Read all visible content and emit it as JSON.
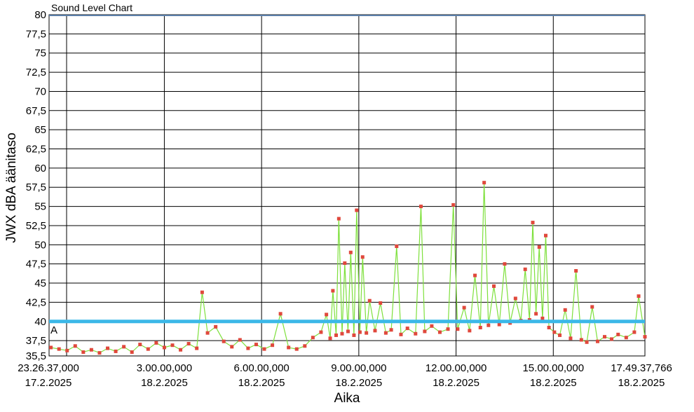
{
  "chart_data": {
    "type": "line",
    "title": "Sound Level Chart",
    "xlabel": "Aika",
    "ylabel": "JWX dBA äänitaso",
    "ylim": [
      35.5,
      80
    ],
    "xlim": [
      "2025-02-17T23:26:37",
      "2025-02-18T17:49:37.766"
    ],
    "grid": true,
    "y_ticks": [
      "80",
      "77,5",
      "75",
      "72,5",
      "70",
      "67,5",
      "65",
      "62,5",
      "60",
      "57,5",
      "55",
      "52,5",
      "50",
      "47,5",
      "45",
      "42,5",
      "40",
      "37,5",
      "35,5"
    ],
    "x_ticks": [
      {
        "time": "2025-02-17T23:26:37",
        "label1": "23.26.37,000",
        "label2": "17.2.2025"
      },
      {
        "time": "2025-02-18T03:00:00",
        "label1": "3.00.00,000",
        "label2": "18.2.2025"
      },
      {
        "time": "2025-02-18T06:00:00",
        "label1": "6.00.00,000",
        "label2": "18.2.2025"
      },
      {
        "time": "2025-02-18T09:00:00",
        "label1": "9.00.00,000",
        "label2": "18.2.2025"
      },
      {
        "time": "2025-02-18T12:00:00",
        "label1": "12.00.00,000",
        "label2": "18.2.2025"
      },
      {
        "time": "2025-02-18T15:00:00",
        "label1": "15.00.00,000",
        "label2": "18.2.2025"
      },
      {
        "time": "2025-02-18T17:49:37.766",
        "label1": "17.49.37,766",
        "label2": "18.2.2025"
      }
    ],
    "reference_line": {
      "value": 40,
      "label": "A",
      "color": "#3bb8e8"
    },
    "series": [
      {
        "color": "#7ee03c",
        "marker_color": "#e0483c",
        "points": [
          [
            "2025-02-17T23:30:00",
            36.6
          ],
          [
            "2025-02-17T23:45:00",
            36.4
          ],
          [
            "2025-02-18T00:00:00",
            36.2
          ],
          [
            "2025-02-18T00:15:00",
            36.8
          ],
          [
            "2025-02-18T00:30:00",
            36.0
          ],
          [
            "2025-02-18T00:45:00",
            36.3
          ],
          [
            "2025-02-18T01:00:00",
            35.9
          ],
          [
            "2025-02-18T01:15:00",
            36.5
          ],
          [
            "2025-02-18T01:30:00",
            36.1
          ],
          [
            "2025-02-18T01:45:00",
            36.7
          ],
          [
            "2025-02-18T02:00:00",
            36.0
          ],
          [
            "2025-02-18T02:15:00",
            37.0
          ],
          [
            "2025-02-18T02:30:00",
            36.4
          ],
          [
            "2025-02-18T02:45:00",
            37.2
          ],
          [
            "2025-02-18T03:00:00",
            36.6
          ],
          [
            "2025-02-18T03:15:00",
            36.9
          ],
          [
            "2025-02-18T03:30:00",
            36.3
          ],
          [
            "2025-02-18T03:45:00",
            37.1
          ],
          [
            "2025-02-18T04:00:00",
            36.5
          ],
          [
            "2025-02-18T04:10:00",
            43.8
          ],
          [
            "2025-02-18T04:20:00",
            38.5
          ],
          [
            "2025-02-18T04:35:00",
            39.3
          ],
          [
            "2025-02-18T04:50:00",
            37.4
          ],
          [
            "2025-02-18T05:05:00",
            36.7
          ],
          [
            "2025-02-18T05:20:00",
            37.6
          ],
          [
            "2025-02-18T05:35:00",
            36.5
          ],
          [
            "2025-02-18T05:50:00",
            37.0
          ],
          [
            "2025-02-18T06:05:00",
            36.4
          ],
          [
            "2025-02-18T06:20:00",
            36.9
          ],
          [
            "2025-02-18T06:35:00",
            41.0
          ],
          [
            "2025-02-18T06:50:00",
            36.6
          ],
          [
            "2025-02-18T07:05:00",
            36.4
          ],
          [
            "2025-02-18T07:20:00",
            36.8
          ],
          [
            "2025-02-18T07:35:00",
            37.9
          ],
          [
            "2025-02-18T07:50:00",
            38.6
          ],
          [
            "2025-02-18T08:00:00",
            40.9
          ],
          [
            "2025-02-18T08:07:00",
            37.8
          ],
          [
            "2025-02-18T08:12:00",
            44.0
          ],
          [
            "2025-02-18T08:18:00",
            38.2
          ],
          [
            "2025-02-18T08:23:00",
            53.4
          ],
          [
            "2025-02-18T08:29:00",
            38.4
          ],
          [
            "2025-02-18T08:34:00",
            47.6
          ],
          [
            "2025-02-18T08:40:00",
            38.7
          ],
          [
            "2025-02-18T08:45:00",
            49.0
          ],
          [
            "2025-02-18T08:51:00",
            38.2
          ],
          [
            "2025-02-18T08:56:00",
            54.5
          ],
          [
            "2025-02-18T09:02:00",
            38.6
          ],
          [
            "2025-02-18T09:07:00",
            48.4
          ],
          [
            "2025-02-18T09:14:00",
            38.5
          ],
          [
            "2025-02-18T09:20:00",
            42.7
          ],
          [
            "2025-02-18T09:30:00",
            38.8
          ],
          [
            "2025-02-18T09:40:00",
            42.4
          ],
          [
            "2025-02-18T09:50:00",
            38.5
          ],
          [
            "2025-02-18T10:00:00",
            38.9
          ],
          [
            "2025-02-18T10:10:00",
            49.8
          ],
          [
            "2025-02-18T10:18:00",
            38.3
          ],
          [
            "2025-02-18T10:30:00",
            39.1
          ],
          [
            "2025-02-18T10:45:00",
            38.4
          ],
          [
            "2025-02-18T10:55:00",
            55.0
          ],
          [
            "2025-02-18T11:02:00",
            38.7
          ],
          [
            "2025-02-18T11:15:00",
            39.4
          ],
          [
            "2025-02-18T11:30:00",
            38.6
          ],
          [
            "2025-02-18T11:45:00",
            39.0
          ],
          [
            "2025-02-18T11:55:00",
            55.2
          ],
          [
            "2025-02-18T12:03:00",
            39.0
          ],
          [
            "2025-02-18T12:15:00",
            41.8
          ],
          [
            "2025-02-18T12:25:00",
            38.8
          ],
          [
            "2025-02-18T12:35:00",
            46.0
          ],
          [
            "2025-02-18T12:45:00",
            39.2
          ],
          [
            "2025-02-18T12:52:00",
            58.1
          ],
          [
            "2025-02-18T13:00:00",
            39.5
          ],
          [
            "2025-02-18T13:10:00",
            44.6
          ],
          [
            "2025-02-18T13:20:00",
            39.6
          ],
          [
            "2025-02-18T13:30:00",
            47.5
          ],
          [
            "2025-02-18T13:40:00",
            39.8
          ],
          [
            "2025-02-18T13:50:00",
            43.0
          ],
          [
            "2025-02-18T14:00:00",
            40.1
          ],
          [
            "2025-02-18T14:08:00",
            46.8
          ],
          [
            "2025-02-18T14:16:00",
            40.2
          ],
          [
            "2025-02-18T14:22:00",
            52.9
          ],
          [
            "2025-02-18T14:28:00",
            41.0
          ],
          [
            "2025-02-18T14:34:00",
            49.7
          ],
          [
            "2025-02-18T14:40:00",
            40.4
          ],
          [
            "2025-02-18T14:46:00",
            51.2
          ],
          [
            "2025-02-18T14:52:00",
            39.2
          ],
          [
            "2025-02-18T15:02:00",
            38.6
          ],
          [
            "2025-02-18T15:12:00",
            38.2
          ],
          [
            "2025-02-18T15:22:00",
            41.5
          ],
          [
            "2025-02-18T15:32:00",
            37.8
          ],
          [
            "2025-02-18T15:42:00",
            46.6
          ],
          [
            "2025-02-18T15:52:00",
            37.6
          ],
          [
            "2025-02-18T16:02:00",
            37.3
          ],
          [
            "2025-02-18T16:12:00",
            41.9
          ],
          [
            "2025-02-18T16:22:00",
            37.4
          ],
          [
            "2025-02-18T16:35:00",
            38.0
          ],
          [
            "2025-02-18T16:48:00",
            37.7
          ],
          [
            "2025-02-18T17:00:00",
            38.3
          ],
          [
            "2025-02-18T17:15:00",
            37.9
          ],
          [
            "2025-02-18T17:30:00",
            38.6
          ],
          [
            "2025-02-18T17:38:00",
            43.3
          ],
          [
            "2025-02-18T17:49:37",
            38.0
          ]
        ]
      }
    ]
  }
}
